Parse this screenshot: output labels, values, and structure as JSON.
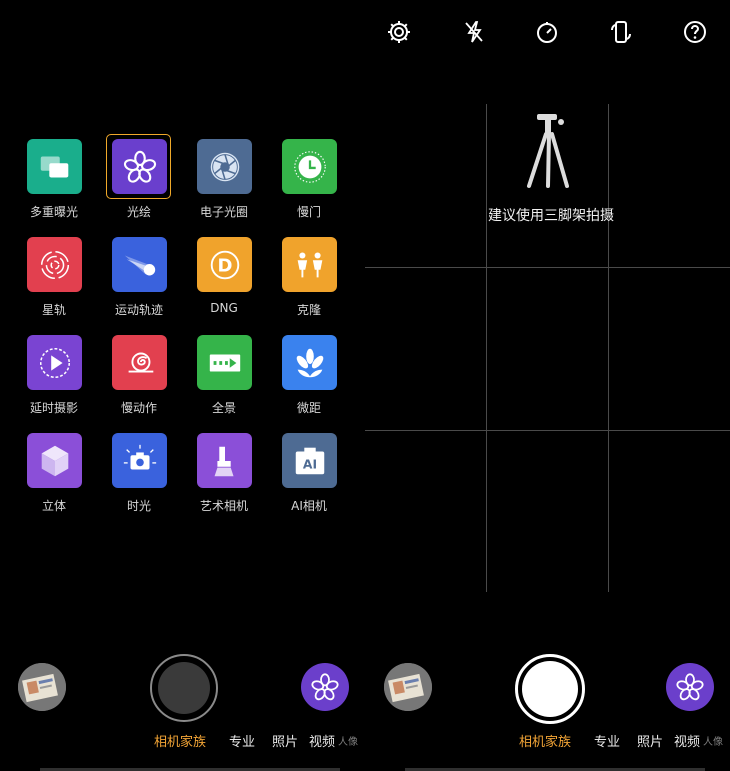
{
  "left_panel": {
    "modes": [
      {
        "label": "多重曝光",
        "icon": "multi-exposure-icon",
        "color": "#1aae8c"
      },
      {
        "label": "光绘",
        "icon": "light-painting-flower-icon",
        "color": "#6a3fcd",
        "selected": true
      },
      {
        "label": "电子光圈",
        "icon": "aperture-icon",
        "color": "#4e6b93"
      },
      {
        "label": "慢门",
        "icon": "slow-shutter-clock-icon",
        "color": "#35b44a"
      },
      {
        "label": "星轨",
        "icon": "star-trail-icon",
        "color": "#e2404f"
      },
      {
        "label": "运动轨迹",
        "icon": "motion-trail-icon",
        "color": "#3a62dd"
      },
      {
        "label": "DNG",
        "icon": "dng-icon",
        "color": "#f0a32c",
        "glyph": "D"
      },
      {
        "label": "克隆",
        "icon": "clone-people-icon",
        "color": "#f0a32c"
      },
      {
        "label": "延时摄影",
        "icon": "timelapse-play-icon",
        "color": "#7a44d2"
      },
      {
        "label": "慢动作",
        "icon": "slow-motion-snail-icon",
        "color": "#e2404f"
      },
      {
        "label": "全景",
        "icon": "panorama-icon",
        "color": "#35b44a"
      },
      {
        "label": "微距",
        "icon": "macro-flower-icon",
        "color": "#3a82ee"
      },
      {
        "label": "立体",
        "icon": "cube-3d-icon",
        "color": "#8b4fd8"
      },
      {
        "label": "时光",
        "icon": "time-light-camera-icon",
        "color": "#3a62dd"
      },
      {
        "label": "艺术相机",
        "icon": "art-brush-icon",
        "color": "#8b4fd8"
      },
      {
        "label": "AI相机",
        "icon": "ai-camera-icon",
        "color": "#4e6b93",
        "glyph": "AI"
      }
    ]
  },
  "right_panel": {
    "top_icons": [
      "settings-gear-icon",
      "flash-off-icon",
      "timer-icon",
      "screen-rotate-icon",
      "help-question-icon"
    ],
    "tripod_hint": "建议使用三脚架拍摄"
  },
  "bottom": {
    "tabs": [
      "相机家族",
      "专业",
      "照片",
      "视频",
      "人像"
    ],
    "active_tab": "相机家族"
  },
  "colors": {
    "accent": "#f3a536",
    "mode_button": "#6b3fcb"
  }
}
